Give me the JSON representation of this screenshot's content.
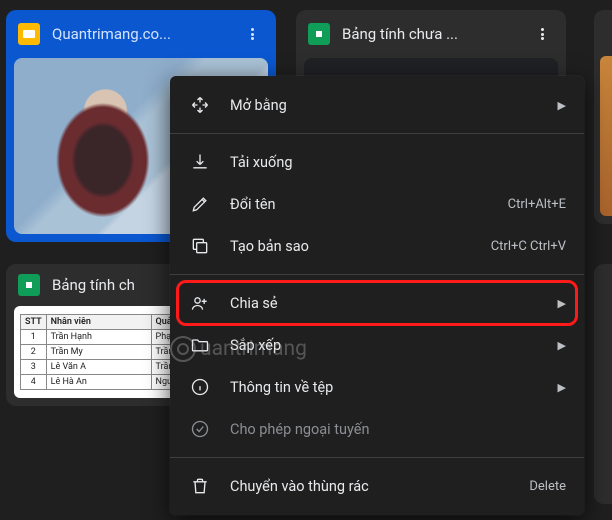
{
  "cards": {
    "top": [
      {
        "title": "Quantrimang.co...",
        "type": "slides",
        "selected": true
      },
      {
        "title": "Bảng tính chưa ...",
        "type": "sheets",
        "selected": false
      }
    ],
    "second_row_title": "Bảng tính ch"
  },
  "context_menu": [
    {
      "icon": "open-with",
      "label": "Mở bằng",
      "submenu": true
    },
    {
      "divider": true
    },
    {
      "icon": "download",
      "label": "Tải xuống"
    },
    {
      "icon": "rename",
      "label": "Đổi tên",
      "shortcut": "Ctrl+Alt+E"
    },
    {
      "icon": "copy",
      "label": "Tạo bản sao",
      "shortcut": "Ctrl+C Ctrl+V"
    },
    {
      "divider": true
    },
    {
      "icon": "share",
      "label": "Chia sẻ",
      "submenu": true,
      "highlight": true
    },
    {
      "icon": "folder",
      "label": "Sắp xếp",
      "submenu": true
    },
    {
      "icon": "info",
      "label": "Thông tin về tệp",
      "submenu": true
    },
    {
      "icon": "offline",
      "label": "Cho phép ngoại tuyến",
      "disabled": true
    },
    {
      "divider": true
    },
    {
      "icon": "trash",
      "label": "Chuyển vào thùng rác",
      "shortcut": "Delete"
    }
  ],
  "sheet_preview": {
    "headers": [
      "STT",
      "Nhân viên",
      "Quản lý"
    ],
    "rows": [
      [
        "1",
        "Trần Hạnh",
        "Phạm Dự"
      ],
      [
        "2",
        "Trần My",
        "Trần Hạnh"
      ],
      [
        "3",
        "Lê Văn A",
        "Trần Hạnh"
      ],
      [
        "4",
        "Lê Hà An",
        "Nguyễn Hà"
      ]
    ]
  },
  "watermark": "uantrimang"
}
